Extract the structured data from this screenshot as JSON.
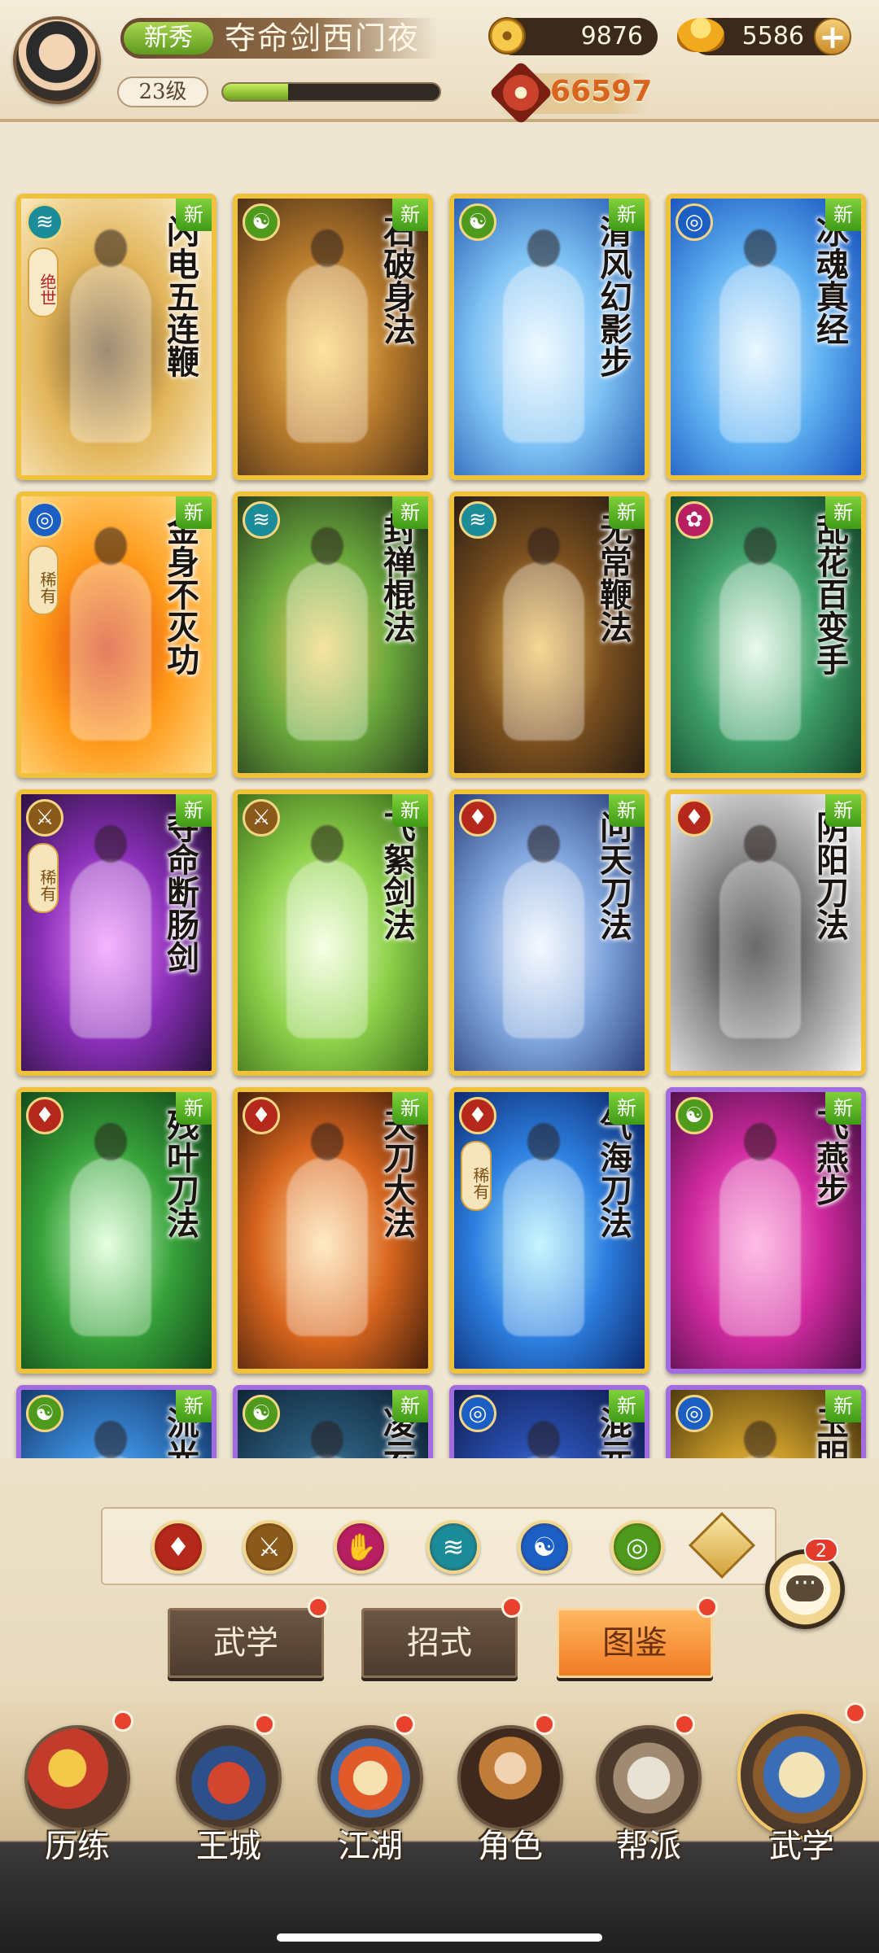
{
  "header": {
    "rank_tag": "新秀",
    "player_name": "夺命剑西门夜",
    "level": "23级",
    "exp_progress": 0.3,
    "coins": "9876",
    "ingots": "5586",
    "power": "66597"
  },
  "cards": [
    {
      "title": "闪电五连鞭",
      "school_icon": "wave-school-icon",
      "rarity": "绝世",
      "new_label": "新",
      "frame": "gold",
      "colors": [
        "#fdf2d2",
        "#e2b55a",
        "#6b4e2a"
      ]
    },
    {
      "title": "石破身法",
      "school_icon": "gourd-school-icon",
      "new_label": "新",
      "frame": "gold",
      "colors": [
        "#3a2414",
        "#b77a2c",
        "#ffd36b"
      ]
    },
    {
      "title": "清风幻影步",
      "school_icon": "gourd-school-icon",
      "new_label": "新",
      "frame": "gold",
      "colors": [
        "#1a4fa8",
        "#7fc2f4",
        "#e6f6ff"
      ]
    },
    {
      "title": "冰魂真经",
      "school_icon": "taiji-school-icon",
      "new_label": "新",
      "frame": "gold",
      "colors": [
        "#0f46b7",
        "#5fb1f2",
        "#dff3ff"
      ]
    },
    {
      "title": "金身不灭功",
      "school_icon": "taiji-school-icon",
      "rarity": "稀有",
      "new_label": "新",
      "frame": "gold",
      "colors": [
        "#ffe69a",
        "#ff9a1a",
        "#d7380b"
      ]
    },
    {
      "title": "封禅棍法",
      "school_icon": "wave-school-icon",
      "new_label": "新",
      "frame": "gold",
      "colors": [
        "#1d2a18",
        "#6aa83c",
        "#f1d56d"
      ]
    },
    {
      "title": "无常鞭法",
      "school_icon": "wave-school-icon",
      "new_label": "新",
      "frame": "gold",
      "colors": [
        "#1b1410",
        "#7a4f1f",
        "#f2c25a"
      ]
    },
    {
      "title": "乱花百变手",
      "school_icon": "lotus-school-icon",
      "new_label": "新",
      "frame": "gold",
      "colors": [
        "#0f3a22",
        "#3fa06a",
        "#dff6e2"
      ]
    },
    {
      "title": "夺命断肠剑",
      "school_icon": "sword-school-icon",
      "rarity": "稀有",
      "new_label": "新",
      "frame": "gold",
      "colors": [
        "#1a0d2a",
        "#8a2fb8",
        "#f08cff"
      ]
    },
    {
      "title": "飞絮剑法",
      "school_icon": "sword-school-icon",
      "new_label": "新",
      "frame": "gold",
      "colors": [
        "#2f5f13",
        "#8ed14a",
        "#f2ffd8"
      ]
    },
    {
      "title": "问天刀法",
      "school_icon": "blade-school-icon",
      "new_label": "新",
      "frame": "gold",
      "colors": [
        "#1c2f6a",
        "#7fa4dc",
        "#eef5ff"
      ]
    },
    {
      "title": "阴阳刀法",
      "school_icon": "blade-school-icon",
      "new_label": "新",
      "frame": "gold",
      "colors": [
        "#ffffff",
        "#8e8e8e",
        "#1a1a1a"
      ]
    },
    {
      "title": "残叶刀法",
      "school_icon": "blade-school-icon",
      "new_label": "新",
      "frame": "gold",
      "colors": [
        "#0d3a15",
        "#37a23a",
        "#d8ffd0"
      ]
    },
    {
      "title": "天刀大法",
      "school_icon": "blade-school-icon",
      "new_label": "新",
      "frame": "gold",
      "colors": [
        "#2a1208",
        "#d9661e",
        "#ffe0a6"
      ]
    },
    {
      "title": "气海刀法",
      "school_icon": "blade-school-icon",
      "rarity": "稀有",
      "new_label": "新",
      "frame": "gold",
      "colors": [
        "#061a5a",
        "#2d7fe0",
        "#a8f0ff"
      ]
    },
    {
      "title": "飞燕步",
      "school_icon": "gourd-school-icon",
      "new_label": "新",
      "frame": "purple",
      "colors": [
        "#3a0b3a",
        "#d12aa0",
        "#ff9ad8"
      ]
    },
    {
      "title": "流光",
      "school_icon": "gourd-school-icon",
      "new_label": "新",
      "frame": "purple",
      "colors": [
        "#0e2a5a",
        "#3a8ad8",
        "#a8e0ff"
      ]
    },
    {
      "title": "凌云",
      "school_icon": "gourd-school-icon",
      "new_label": "新",
      "frame": "purple",
      "colors": [
        "#0a1a2a",
        "#2a5a7a",
        "#9ad4ea"
      ]
    },
    {
      "title": "混元",
      "school_icon": "taiji-school-icon",
      "new_label": "新",
      "frame": "purple",
      "colors": [
        "#0a1440",
        "#2a4fb0",
        "#7fb2ff"
      ]
    },
    {
      "title": "玉明",
      "school_icon": "taiji-school-icon",
      "new_label": "新",
      "frame": "purple",
      "colors": [
        "#3a2a08",
        "#c89a2a",
        "#ffe08a"
      ]
    }
  ],
  "filters": [
    {
      "name": "blade-filter-icon",
      "color": "#b5281c"
    },
    {
      "name": "sword-filter-icon",
      "color": "#8a5a1a"
    },
    {
      "name": "palm-filter-icon",
      "color": "#b81f63"
    },
    {
      "name": "wave-filter-icon",
      "color": "#1b8c98"
    },
    {
      "name": "taiji-filter-icon",
      "color": "#1c5fc4"
    },
    {
      "name": "gourd-filter-icon",
      "color": "#4e9a1c"
    }
  ],
  "chat_badge": "2",
  "sub_tabs": {
    "martial": "武学",
    "moves": "招式",
    "atlas": "图鉴"
  },
  "nav": {
    "trials": "历练",
    "city": "王城",
    "jianghu": "江湖",
    "character": "角色",
    "guild": "帮派",
    "martial": "武学"
  }
}
